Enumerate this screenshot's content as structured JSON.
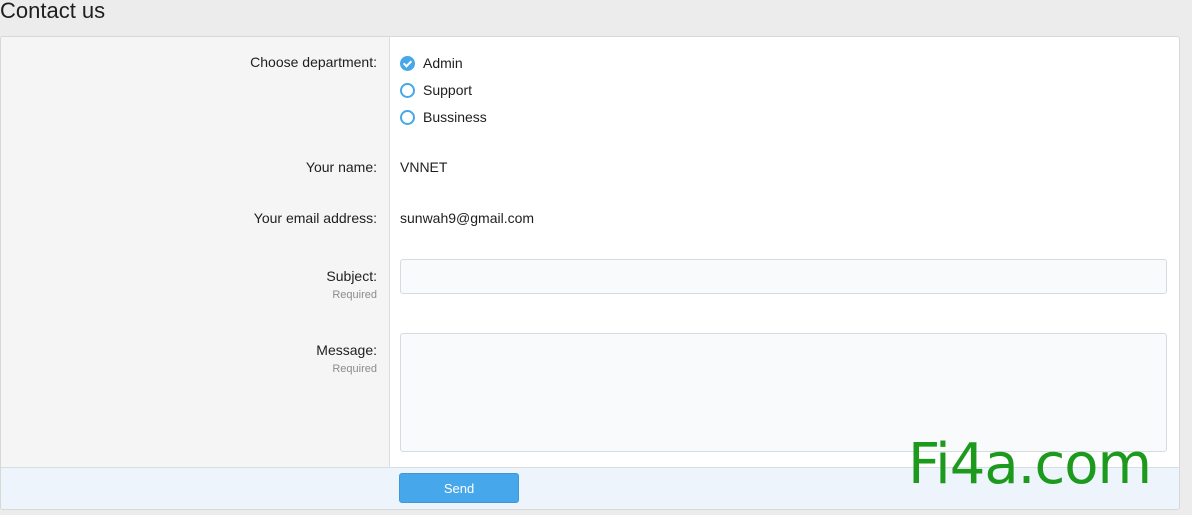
{
  "page": {
    "title": "Contact us"
  },
  "form": {
    "department": {
      "label": "Choose department:",
      "options": [
        {
          "label": "Admin",
          "checked": true
        },
        {
          "label": "Support",
          "checked": false
        },
        {
          "label": "Bussiness",
          "checked": false
        }
      ]
    },
    "name": {
      "label": "Your name:",
      "value": "VNNET"
    },
    "email": {
      "label": "Your email address:",
      "value": "sunwah9@gmail.com"
    },
    "subject": {
      "label": "Subject:",
      "hint": "Required",
      "value": "",
      "placeholder": ""
    },
    "message": {
      "label": "Message:",
      "hint": "Required",
      "value": "",
      "placeholder": ""
    },
    "send_label": "Send"
  },
  "watermark": {
    "text": "Fi4a.com"
  },
  "colors": {
    "accent": "#47a7eb",
    "watermark": "#1d9a1d",
    "page_background": "#ececec",
    "label_column": "#f5f5f5",
    "footer": "#edf4fb"
  }
}
